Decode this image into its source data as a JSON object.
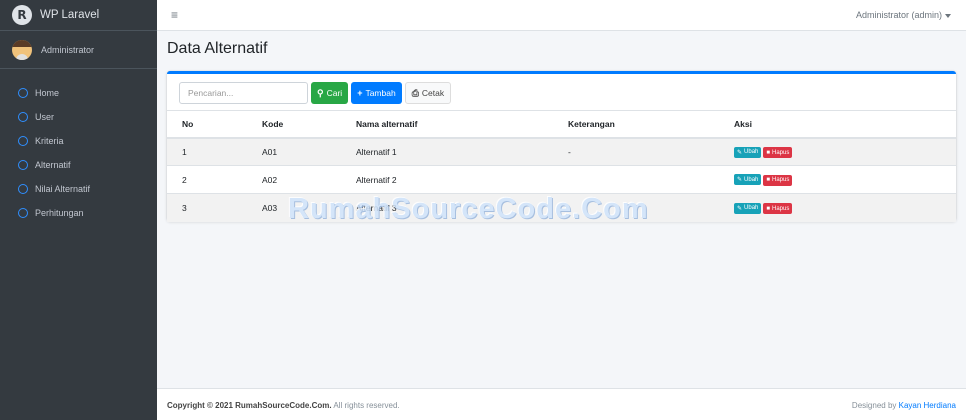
{
  "brand": {
    "title": "WP Laravel",
    "logo_letter": "R"
  },
  "sidebar": {
    "user_name": "Administrator",
    "items": [
      {
        "label": "Home"
      },
      {
        "label": "User"
      },
      {
        "label": "Kriteria"
      },
      {
        "label": "Alternatif"
      },
      {
        "label": "Nilai Alternatif"
      },
      {
        "label": "Perhitungan"
      }
    ]
  },
  "topbar": {
    "menu_icon": "≡",
    "user_menu": "Administrator (admin)"
  },
  "main": {
    "page_title": "Data Alternatif",
    "search_placeholder": "Pencarian...",
    "buttons": {
      "search": "Cari",
      "add": "Tambah",
      "print": "Cetak"
    },
    "table": {
      "headers": [
        "No",
        "Kode",
        "Nama alternatif",
        "Keterangan",
        "Aksi"
      ],
      "rows": [
        {
          "no": "1",
          "kode": "A01",
          "nama": "Alternatif 1",
          "keterangan": "-"
        },
        {
          "no": "2",
          "kode": "A02",
          "nama": "Alternatif 2",
          "keterangan": ""
        },
        {
          "no": "3",
          "kode": "A03",
          "nama": "Alternatif 3",
          "keterangan": ""
        }
      ],
      "edit_label": "Ubah",
      "delete_label": "Hapus"
    }
  },
  "watermark": "RumahSourceCode.Com",
  "footer": {
    "copyright_prefix": "Copyright © 2021 ",
    "copyright_site": "RumahSourceCode.Com.",
    "copyright_suffix": " All rights reserved.",
    "designed_by": "Designed by ",
    "author": "Kayan Herdiana"
  },
  "colors": {
    "sidebar": "#343a40",
    "primary": "#007bff",
    "success": "#28a745",
    "info": "#17a2b8",
    "danger": "#dc3545"
  }
}
